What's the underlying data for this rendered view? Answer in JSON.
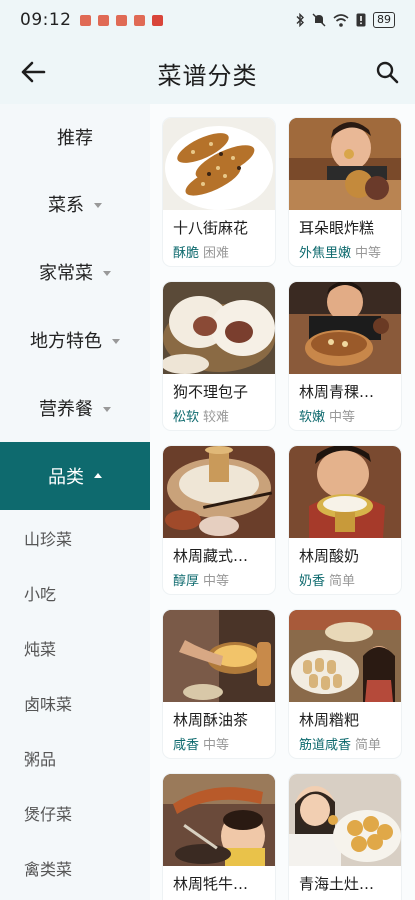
{
  "status": {
    "time": "09:12",
    "battery": "89"
  },
  "header": {
    "title": "菜谱分类"
  },
  "sidebar": {
    "items": [
      {
        "label": "推荐"
      },
      {
        "label": "菜系"
      },
      {
        "label": "家常菜"
      },
      {
        "label": "地方特色"
      },
      {
        "label": "营养餐"
      },
      {
        "label": "品类"
      }
    ],
    "sub_items": [
      "山珍菜",
      "小吃",
      "炖菜",
      "卤味菜",
      "粥品",
      "煲仔菜",
      "禽类菜"
    ]
  },
  "dishes": [
    {
      "name": "十八街麻花",
      "tag1": "酥脆",
      "tag2": "困难",
      "icon": "fried-dough-twist-photo"
    },
    {
      "name": "耳朵眼炸糕",
      "tag1": "外焦里嫩",
      "tag2": "中等",
      "icon": "fried-cake-photo"
    },
    {
      "name": "狗不理包子",
      "tag1": "松软",
      "tag2": "较难",
      "icon": "steamed-bun-photo"
    },
    {
      "name": "林周青稞…",
      "tag1": "软嫩",
      "tag2": "中等",
      "icon": "barley-dish-photo"
    },
    {
      "name": "林周藏式…",
      "tag1": "醇厚",
      "tag2": "中等",
      "icon": "tibetan-hotpot-photo"
    },
    {
      "name": "林周酸奶",
      "tag1": "奶香",
      "tag2": "简单",
      "icon": "yogurt-photo"
    },
    {
      "name": "林周酥油茶",
      "tag1": "咸香",
      "tag2": "中等",
      "icon": "butter-tea-photo"
    },
    {
      "name": "林周糌粑",
      "tag1": "筋道咸香",
      "tag2": "简单",
      "icon": "tsampa-photo"
    },
    {
      "name": "林周牦牛…",
      "tag1": "",
      "tag2": "",
      "icon": "yak-meat-photo"
    },
    {
      "name": "青海土灶…",
      "tag1": "",
      "tag2": "",
      "icon": "qinghai-stove-photo"
    }
  ]
}
